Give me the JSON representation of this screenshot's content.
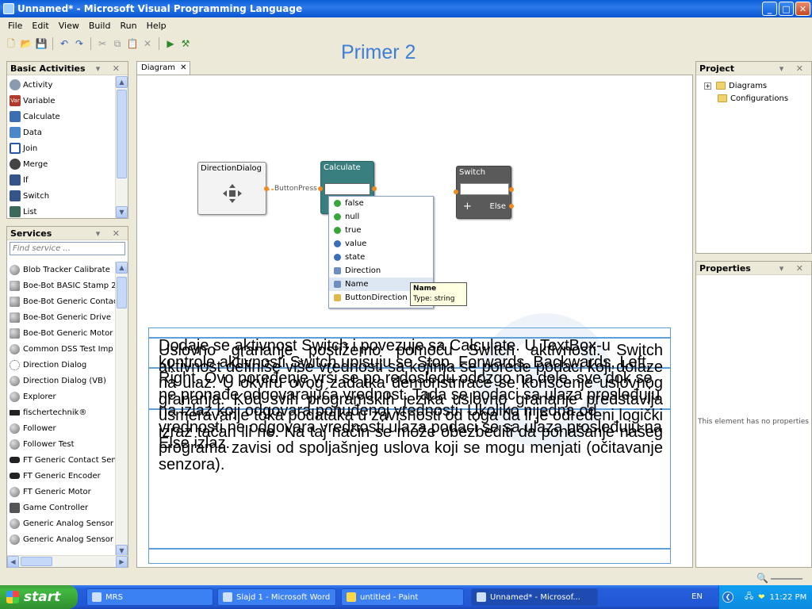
{
  "window": {
    "title": "Unnamed* - Microsoft Visual Programming Language"
  },
  "menu": [
    "File",
    "Edit",
    "View",
    "Build",
    "Run",
    "Help"
  ],
  "slide_heading": "Primer 2",
  "basic_activities": {
    "title": "Basic Activities",
    "items": [
      {
        "label": "Activity",
        "icon": "activity-icon",
        "color": "#8a9bb0"
      },
      {
        "label": "Variable",
        "icon": "variable-icon",
        "color": "#b13a2a",
        "glyph": "Var"
      },
      {
        "label": "Calculate",
        "icon": "calculate-icon",
        "color": "#3c6fb2"
      },
      {
        "label": "Data",
        "icon": "data-icon",
        "color": "#4a88c9"
      },
      {
        "label": "Join",
        "icon": "join-icon",
        "color": "#2a58a8"
      },
      {
        "label": "Merge",
        "icon": "merge-icon",
        "color": "#444444"
      },
      {
        "label": "If",
        "icon": "if-icon",
        "color": "#35558a"
      },
      {
        "label": "Switch",
        "icon": "switch-icon",
        "color": "#35558a"
      },
      {
        "label": "List",
        "icon": "list-icon",
        "color": "#3c6a5a"
      }
    ]
  },
  "services": {
    "title": "Services",
    "search_placeholder": "Find service ...",
    "items": [
      "Blob Tracker Calibrate",
      "Boe-Bot BASIC Stamp 2",
      "Boe-Bot Generic Contac",
      "Boe-Bot Generic Drive",
      "Boe-Bot Generic Motor",
      "Common DSS Test Imp",
      "Direction Dialog",
      "Direction Dialog (VB)",
      "Explorer",
      "fischertechnik®",
      "Follower",
      "Follower Test",
      "FT Generic Contact Sen",
      "FT Generic Encoder",
      "FT Generic Motor",
      "Game Controller",
      "Generic Analog Sensor",
      "Generic Analog Sensor"
    ]
  },
  "diagram": {
    "tab_label": "Diagram",
    "direction_node": "DirectionDialog",
    "connection_label": "ButtonPress",
    "calculate_node": "Calculate",
    "switch_node": "Switch",
    "switch_plus": "+",
    "switch_else": "Else"
  },
  "dropdown": {
    "items": [
      {
        "label": "false",
        "icon": "green-dot",
        "color": "#3aa63a"
      },
      {
        "label": "null",
        "icon": "green-dot",
        "color": "#3aa63a"
      },
      {
        "label": "true",
        "icon": "green-dot",
        "color": "#3aa63a"
      },
      {
        "label": "value",
        "icon": "blue-dot",
        "color": "#3b6fb5"
      },
      {
        "label": "state",
        "icon": "blue-dot",
        "color": "#3b6fb5"
      },
      {
        "label": "Direction",
        "icon": "property-icon",
        "color": "#6d8fbf"
      },
      {
        "label": "Name",
        "icon": "property-icon",
        "color": "#6d8fbf"
      },
      {
        "label": "ButtonDirection",
        "icon": "property-icon",
        "color": "#e0b84a"
      }
    ],
    "tooltip_title": "Name",
    "tooltip_type": "Type:  string"
  },
  "overlay": {
    "text_a": "Dodaje se aktivnost Switch i povezuje sa Calculate. U TextBox-u kontrole aktivnosti Switch upisuju se Stop, Forwards, Backwards, Left, Right. Ovo poređenje vrši se po redosledu odozgo na dole, sve dok se ne pronađe odgovarajuća vrednost. Tada se podaci sa ulaza prosleđuju na izlaz koji odgovara ponuđenoj vrednosti. Ukoliko nijedna od vrednosti ne odgovara vrednosti ulaza podaci se sa ulaza prosleđuju na Else izlaz.",
    "text_b": "Uslovno grananje postižemo pomoću Switch aktivnosti. Switch aktivnost definiše više vrednosti sa kojima se porede podaci koji dolaze na ulaz. U okviru ovog zadatka demonstriraće se korišćenje uslovnog grananja. Kod svih programskih jezika uslovno grananje predstavlja usmeravanje toka podataka u zavisnosti od toga da li je određeni logički izraz tačan ili ne. Na taj način se može obezbediti da ponašanje našeg programa zavisi od spoljašnjeg uslova koji se mogu menjati (očitavanje senzora)."
  },
  "project": {
    "title": "Project",
    "items": [
      "Diagrams",
      "Configurations"
    ]
  },
  "properties": {
    "title": "Properties",
    "empty_text": "This element has no properties"
  },
  "taskbar": {
    "start": "start",
    "tasks": [
      {
        "label": "MRS",
        "active": false
      },
      {
        "label": "Slajd 1 - Microsoft Word",
        "active": false
      },
      {
        "label": "untitled - Paint",
        "active": false
      },
      {
        "label": "Unnamed* - Microsof...",
        "active": true
      }
    ],
    "lang": "EN",
    "clock": "11:22 PM"
  }
}
